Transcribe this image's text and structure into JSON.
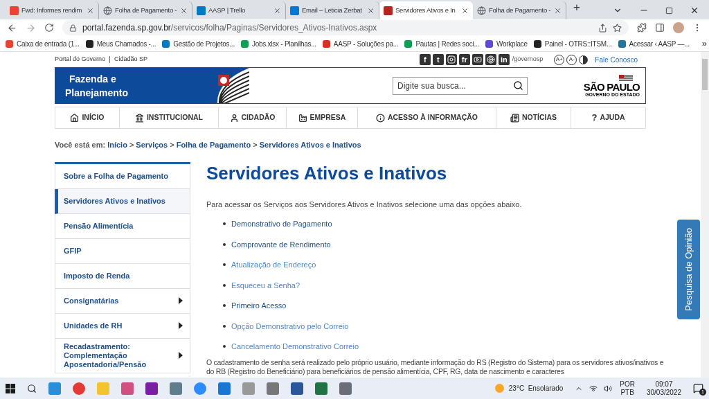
{
  "browser": {
    "tabs": [
      {
        "title": "Fwd: Informes rendim",
        "selected": false
      },
      {
        "title": "Folha de Pagamento -",
        "selected": false
      },
      {
        "title": "AASP | Trello",
        "selected": false
      },
      {
        "title": "Email – Leticia Zerbat",
        "selected": false
      },
      {
        "title": "Servidores Ativos e In",
        "selected": true
      },
      {
        "title": "Folha de Pagamento -",
        "selected": false
      }
    ],
    "new_tab": "+",
    "url_host": "portal.fazenda.sp.gov.br",
    "url_path": "/servicos/folha/Paginas/Servidores_Ativos-Inativos.aspx",
    "bookmarks": [
      "Caixa de entrada (1...",
      "Meus Chamados -...",
      "Gestão de Projetos...",
      "Jobs.xlsx - Planilhas...",
      "AASP - Soluções pa...",
      "Pautas | Redes soci...",
      "Workplace",
      "Painel - OTRS::ITSM...",
      "Acessar ‹ AASP —..."
    ],
    "bookmarks_more": "»"
  },
  "page": {
    "top_links": [
      "Portal do Governo",
      "Cidadão SP"
    ],
    "socials": [
      {
        "kind": "text",
        "glyph": "f"
      },
      {
        "kind": "text",
        "glyph": "t"
      },
      {
        "kind": "instagram"
      },
      {
        "kind": "text",
        "glyph": "fr"
      },
      {
        "kind": "youtube"
      },
      {
        "kind": "target"
      },
      {
        "kind": "text",
        "glyph": "in"
      }
    ],
    "social_handle": "/governosp",
    "accessibility": [
      "A+",
      "A-"
    ],
    "contact": "Fale Conosco",
    "brand": [
      "Fazenda e",
      "Planejamento"
    ],
    "search": {
      "placeholder": "Digite sua busca..."
    },
    "state_logo": {
      "name": "SÃO PAULO",
      "subtitle": "GOVERNO DO ESTADO"
    },
    "nav": [
      {
        "kind": "home",
        "label": "INÍCIO"
      },
      {
        "kind": "institution",
        "label": "INSTITUCIONAL"
      },
      {
        "kind": "person",
        "label": "CIDADÃO"
      },
      {
        "kind": "factory",
        "label": "EMPRESA"
      },
      {
        "kind": "info",
        "label": "ACESSO À INFORMAÇÃO"
      },
      {
        "kind": "news",
        "label": "NOTÍCIAS"
      },
      {
        "kind": "help",
        "label": "AJUDA"
      }
    ],
    "help_glyph": "?",
    "breadcrumb": {
      "prefix": "Você está em:",
      "items": [
        "Início",
        "Serviços",
        "Folha de Pagamento",
        "Servidores Ativos e Inativos"
      ],
      "separator": ">"
    },
    "sidebar": [
      {
        "label": "Sobre a Folha de Pagamento",
        "selected": false,
        "expandable": false
      },
      {
        "label": "Servidores Ativos e Inativos",
        "selected": true,
        "expandable": false
      },
      {
        "label": "Pensão Alimentícia",
        "selected": false,
        "expandable": false
      },
      {
        "label": "GFIP",
        "selected": false,
        "expandable": false
      },
      {
        "label": "Imposto de Renda",
        "selected": false,
        "expandable": false
      },
      {
        "label": "Consignatárias",
        "selected": false,
        "expandable": true
      },
      {
        "label": "Unidades de RH",
        "selected": false,
        "expandable": true
      },
      {
        "label": "Recadastramento: Complementação Aposentadoria/Pensão",
        "selected": false,
        "expandable": true
      }
    ],
    "title": "Servidores Ativos e Inativos",
    "intro": "Para acessar os Serviços aos Servidores Ativos e Inativos selecione uma das opções abaixo.",
    "links": [
      {
        "label": "Demonstrativo de Pagamento",
        "visited": false
      },
      {
        "label": "Comprovante de Rendimento",
        "visited": false
      },
      {
        "label": "Atualização de Endereço",
        "visited": true
      },
      {
        "label": "Esqueceu a Senha?",
        "visited": true
      },
      {
        "label": "Primeiro Acesso",
        "visited": false
      },
      {
        "label": "Opção Demonstrativo pelo Correio",
        "visited": true
      },
      {
        "label": "Cancelamento Demonstrativo Correio",
        "visited": true
      }
    ],
    "note": "O cadastramento de senha será realizado pelo próprio usuário, mediante informação do RS (Registro do Sistema) para os servidores ativos/inativos e do RB (Registro do Beneficiário) para beneficiários de pensão alimentícia, CPF, RG, data de nascimento e caracteres",
    "survey": "Pesquisa de Opinião"
  },
  "taskbar": {
    "weather": "23°C  Ensolarado",
    "lang": [
      "POR",
      "PTB"
    ],
    "time": "09:07",
    "date": "30/03/2022",
    "notifications": "1"
  }
}
